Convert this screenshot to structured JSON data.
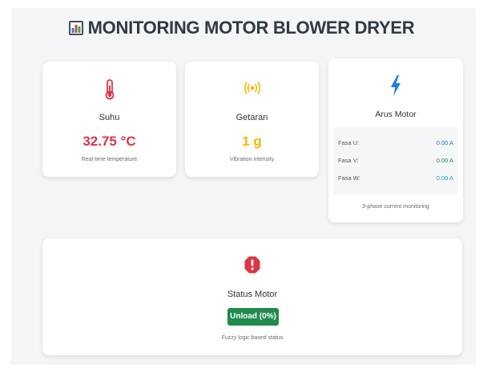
{
  "header": {
    "title": "MONITORING MOTOR BLOWER DRYER",
    "icon": "bar-chart-icon"
  },
  "suhu": {
    "title": "Suhu",
    "value": "32.75 °C",
    "subtitle": "Real-time temperature",
    "icon": "thermometer-icon",
    "color": "#dc3545"
  },
  "getaran": {
    "title": "Getaran",
    "value": "1 g",
    "subtitle": "Vibration intensity",
    "icon": "vibration-icon",
    "color": "#f5b800"
  },
  "arus": {
    "title": "Arus Motor",
    "icon": "lightning-icon",
    "icon_color": "#1e7be8",
    "phases": [
      {
        "label": "Fasa U:",
        "value": "0.00 A",
        "color": "#1e6fd8"
      },
      {
        "label": "Fasa V:",
        "value": "0.00 A",
        "color": "#1f8a4c"
      },
      {
        "label": "Fasa W:",
        "value": "0.00 A",
        "color": "#17a2b8"
      }
    ],
    "subtitle": "3-phase current monitoring"
  },
  "status": {
    "title": "Status Motor",
    "icon": "alert-octagon-icon",
    "icon_color": "#dc3545",
    "badge": "Unload (0%)",
    "badge_color": "#1f8a4c",
    "subtitle": "Fuzzy logic based status"
  }
}
